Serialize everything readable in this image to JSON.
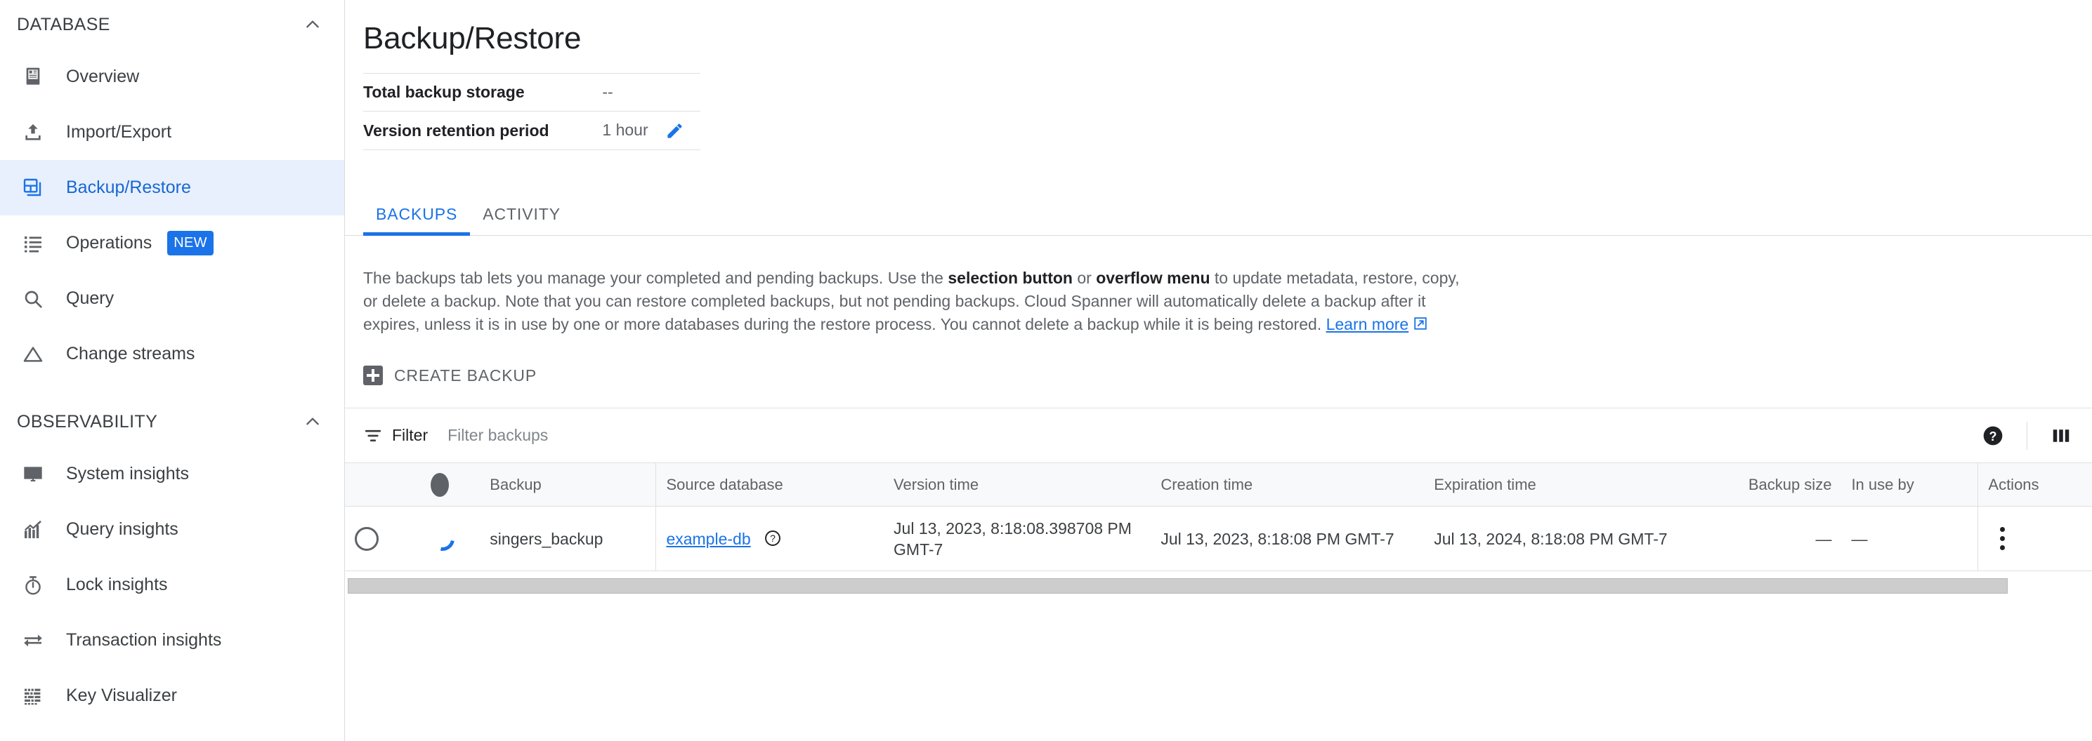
{
  "sidebar": {
    "sections": [
      {
        "label": "DATABASE",
        "collapse_icon": "chevron-up-icon",
        "items": [
          {
            "label": "Overview",
            "icon": "overview-icon",
            "active": false,
            "badge": ""
          },
          {
            "label": "Import/Export",
            "icon": "import-export-icon",
            "active": false,
            "badge": ""
          },
          {
            "label": "Backup/Restore",
            "icon": "backup-restore-icon",
            "active": true,
            "badge": ""
          },
          {
            "label": "Operations",
            "icon": "list-icon",
            "active": false,
            "badge": "NEW"
          },
          {
            "label": "Query",
            "icon": "search-icon",
            "active": false,
            "badge": ""
          },
          {
            "label": "Change streams",
            "icon": "triangle-icon",
            "active": false,
            "badge": ""
          }
        ]
      },
      {
        "label": "OBSERVABILITY",
        "collapse_icon": "chevron-up-icon",
        "items": [
          {
            "label": "System insights",
            "icon": "monitor-chart-icon",
            "active": false,
            "badge": ""
          },
          {
            "label": "Query insights",
            "icon": "bar-chart-icon",
            "active": false,
            "badge": ""
          },
          {
            "label": "Lock insights",
            "icon": "stopwatch-icon",
            "active": false,
            "badge": ""
          },
          {
            "label": "Transaction insights",
            "icon": "swap-arrows-icon",
            "active": false,
            "badge": ""
          },
          {
            "label": "Key Visualizer",
            "icon": "key-visualizer-icon",
            "active": false,
            "badge": ""
          }
        ]
      }
    ]
  },
  "page": {
    "title": "Backup/Restore",
    "summary": [
      {
        "label": "Total backup storage",
        "value": "--",
        "editable": false
      },
      {
        "label": "Version retention period",
        "value": "1 hour",
        "editable": true
      }
    ],
    "edit_icon": "pencil-icon"
  },
  "tabs": [
    {
      "label": "BACKUPS",
      "active": true
    },
    {
      "label": "ACTIVITY",
      "active": false
    }
  ],
  "description": {
    "part1": "The backups tab lets you manage your completed and pending backups. Use the ",
    "bold1": "selection button",
    "part2": " or ",
    "bold2": "overflow menu",
    "part3": " to update metadata, restore, copy, or delete a backup. Note that you can restore completed backups, but not pending backups. Cloud Spanner will automatically delete a backup after it expires, unless it is in use by one or more databases during the restore process. You cannot delete a backup while it is being restored. ",
    "link_text": "Learn more",
    "link_icon": "external-link-icon"
  },
  "toolbar": {
    "create_backup_label": "CREATE BACKUP",
    "create_icon": "plus-box-icon"
  },
  "filter": {
    "icon": "filter-icon",
    "label": "Filter",
    "value": "",
    "placeholder": "Filter backups",
    "help_icon": "help-filled-icon",
    "columns_icon": "column-settings-icon"
  },
  "table": {
    "columns": [
      {
        "key": "select",
        "label": ""
      },
      {
        "key": "status",
        "label": ""
      },
      {
        "key": "backup",
        "label": "Backup"
      },
      {
        "key": "source",
        "label": "Source database"
      },
      {
        "key": "version",
        "label": "Version time"
      },
      {
        "key": "created",
        "label": "Creation time"
      },
      {
        "key": "expires",
        "label": "Expiration time"
      },
      {
        "key": "size",
        "label": "Backup size"
      },
      {
        "key": "inuse",
        "label": "In use by"
      },
      {
        "key": "actions",
        "label": "Actions"
      }
    ],
    "rows": [
      {
        "selected": false,
        "status_icon": "spinner-icon",
        "backup": "singers_backup",
        "source": "example-db",
        "source_help_icon": "help-outline-icon",
        "version": "Jul 13, 2023, 8:18:08.398708 PM GMT-7",
        "created": "Jul 13, 2023, 8:18:08 PM GMT-7",
        "expires": "Jul 13, 2024, 8:18:08 PM GMT-7",
        "size": "—",
        "inuse": "—",
        "actions_icon": "more-vert-icon"
      }
    ]
  },
  "colors": {
    "accent": "#1a73e8",
    "accent_text": "#1967d2",
    "active_bg": "#e8f0fe",
    "text_primary": "#202124",
    "text_secondary": "#5f6368",
    "border": "#e0e0e0",
    "header_bg": "#f8f9fa",
    "scrollbar": "#cdcdcd"
  }
}
